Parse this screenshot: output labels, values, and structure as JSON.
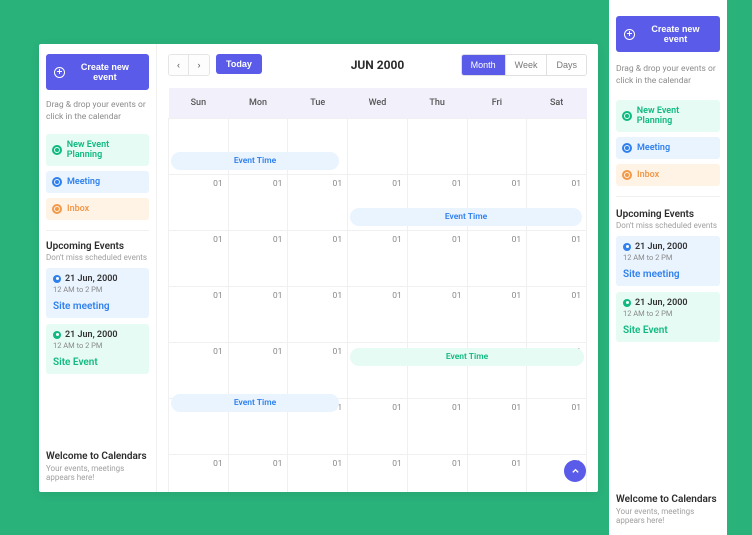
{
  "buttons": {
    "create_event": "Create new event",
    "today": "Today"
  },
  "instructions": "Drag & drop your events or click in the calendar",
  "tags": {
    "planning": "New Event Planning",
    "meeting": "Meeting",
    "inbox": "Inbox"
  },
  "upcoming": {
    "title": "Upcoming Events",
    "subtitle": "Don't miss scheduled events",
    "items": [
      {
        "date": "21 Jun, 2000",
        "time": "12 AM to 2 PM",
        "title": "Site meeting"
      },
      {
        "date": "21 Jun, 2000",
        "time": "12 AM to 2 PM",
        "title": "Site Event"
      }
    ]
  },
  "welcome": {
    "title": "Welcome to Calendars",
    "subtitle": "Your events, meetings appears here!"
  },
  "calendar": {
    "title": "JUN 2000",
    "views": {
      "month": "Month",
      "week": "Week",
      "days": "Days"
    },
    "days": [
      "Sun",
      "Mon",
      "Tue",
      "Wed",
      "Thu",
      "Fri",
      "Sat"
    ],
    "cell_number": "01",
    "events": {
      "event_time": "Event Time"
    }
  }
}
